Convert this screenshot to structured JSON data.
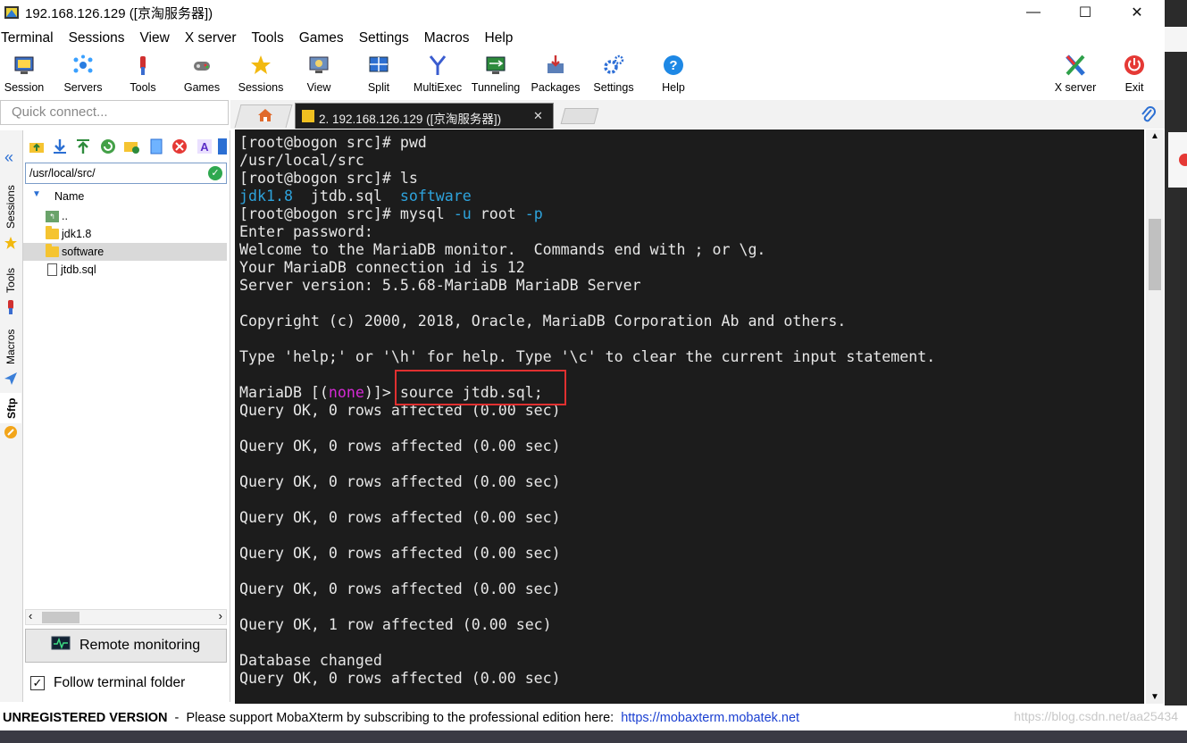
{
  "window": {
    "title": "192.168.126.129 ([京淘服务器])",
    "minimize": "—",
    "maximize": "☐",
    "close": "✕"
  },
  "menu": [
    "Terminal",
    "Sessions",
    "View",
    "X server",
    "Tools",
    "Games",
    "Settings",
    "Macros",
    "Help"
  ],
  "toolbar": {
    "buttons": [
      {
        "label": "Session",
        "icon": "session-icon"
      },
      {
        "label": "Servers",
        "icon": "servers-icon"
      },
      {
        "label": "Tools",
        "icon": "tools-icon"
      },
      {
        "label": "Games",
        "icon": "games-icon"
      },
      {
        "label": "Sessions",
        "icon": "star-icon"
      },
      {
        "label": "View",
        "icon": "view-icon"
      },
      {
        "label": "Split",
        "icon": "split-icon"
      },
      {
        "label": "MultiExec",
        "icon": "multiexec-icon"
      },
      {
        "label": "Tunneling",
        "icon": "tunneling-icon"
      },
      {
        "label": "Packages",
        "icon": "packages-icon"
      },
      {
        "label": "Settings",
        "icon": "settings-icon"
      },
      {
        "label": "Help",
        "icon": "help-icon"
      }
    ],
    "xserver_label": "X server",
    "exit_label": "Exit"
  },
  "quick_connect": {
    "placeholder": "Quick connect..."
  },
  "tabs": {
    "home_icon": "home-icon",
    "active_tab_label": "2.  192.168.126.129  ([京淘服务器])",
    "active_tab_close": "✕"
  },
  "side_tabs": [
    "Sessions",
    "Tools",
    "Macros",
    "Sftp"
  ],
  "sftp": {
    "path": "/usr/local/src/",
    "column_name": "Name",
    "files": [
      {
        "name": "..",
        "type": "parent"
      },
      {
        "name": "jdk1.8",
        "type": "folder"
      },
      {
        "name": "software",
        "type": "folder",
        "selected": true
      },
      {
        "name": "jtdb.sql",
        "type": "file"
      }
    ],
    "remote_monitoring": "Remote monitoring",
    "follow_terminal_folder": "Follow terminal folder",
    "follow_checked": true
  },
  "terminal": {
    "lines": [
      {
        "segments": [
          {
            "t": "[root@bogon src]# pwd"
          }
        ]
      },
      {
        "segments": [
          {
            "t": "/usr/local/src"
          }
        ]
      },
      {
        "segments": [
          {
            "t": "[root@bogon src]# ls"
          }
        ]
      },
      {
        "segments": [
          {
            "t": "jdk1.8",
            "c": "c-blue"
          },
          {
            "t": "  jtdb.sql  "
          },
          {
            "t": "software",
            "c": "c-blue"
          }
        ]
      },
      {
        "segments": [
          {
            "t": "[root@bogon src]# mysql "
          },
          {
            "t": "-u",
            "c": "c-blue"
          },
          {
            "t": " root "
          },
          {
            "t": "-p",
            "c": "c-blue"
          }
        ]
      },
      {
        "segments": [
          {
            "t": "Enter password:"
          }
        ]
      },
      {
        "segments": [
          {
            "t": "Welcome to the MariaDB monitor.  Commands end with ; or \\g."
          }
        ]
      },
      {
        "segments": [
          {
            "t": "Your MariaDB connection id is 12"
          }
        ]
      },
      {
        "segments": [
          {
            "t": "Server version: 5.5.68-MariaDB MariaDB Server"
          }
        ]
      },
      {
        "segments": [
          {
            "t": ""
          }
        ]
      },
      {
        "segments": [
          {
            "t": "Copyright (c) 2000, 2018, Oracle, MariaDB Corporation Ab and others."
          }
        ]
      },
      {
        "segments": [
          {
            "t": ""
          }
        ]
      },
      {
        "segments": [
          {
            "t": "Type 'help;' or '\\h' for help. Type '\\c' to clear the current input statement."
          }
        ]
      },
      {
        "segments": [
          {
            "t": ""
          }
        ]
      },
      {
        "segments": [
          {
            "t": "MariaDB [("
          },
          {
            "t": "none",
            "c": "c-mag"
          },
          {
            "t": ")]> source jtdb.sql;"
          }
        ]
      },
      {
        "segments": [
          {
            "t": "Query OK, 0 rows affected (0.00 sec)"
          }
        ]
      },
      {
        "segments": [
          {
            "t": ""
          }
        ]
      },
      {
        "segments": [
          {
            "t": "Query OK, 0 rows affected (0.00 sec)"
          }
        ]
      },
      {
        "segments": [
          {
            "t": ""
          }
        ]
      },
      {
        "segments": [
          {
            "t": "Query OK, 0 rows affected (0.00 sec)"
          }
        ]
      },
      {
        "segments": [
          {
            "t": ""
          }
        ]
      },
      {
        "segments": [
          {
            "t": "Query OK, 0 rows affected (0.00 sec)"
          }
        ]
      },
      {
        "segments": [
          {
            "t": ""
          }
        ]
      },
      {
        "segments": [
          {
            "t": "Query OK, 0 rows affected (0.00 sec)"
          }
        ]
      },
      {
        "segments": [
          {
            "t": ""
          }
        ]
      },
      {
        "segments": [
          {
            "t": "Query OK, 0 rows affected (0.00 sec)"
          }
        ]
      },
      {
        "segments": [
          {
            "t": ""
          }
        ]
      },
      {
        "segments": [
          {
            "t": "Query OK, 1 row affected (0.00 sec)"
          }
        ]
      },
      {
        "segments": [
          {
            "t": ""
          }
        ]
      },
      {
        "segments": [
          {
            "t": "Database changed"
          }
        ]
      },
      {
        "segments": [
          {
            "t": "Query OK, 0 rows affected (0.00 sec)"
          }
        ]
      }
    ],
    "highlight_color": "#e03030"
  },
  "status": {
    "unregistered": "UNREGISTERED VERSION",
    "message": "  -  Please support MobaXterm by subscribing to the professional edition here:",
    "link": "https://mobaxterm.mobatek.net",
    "watermark": "https://blog.csdn.net/aa25434"
  }
}
